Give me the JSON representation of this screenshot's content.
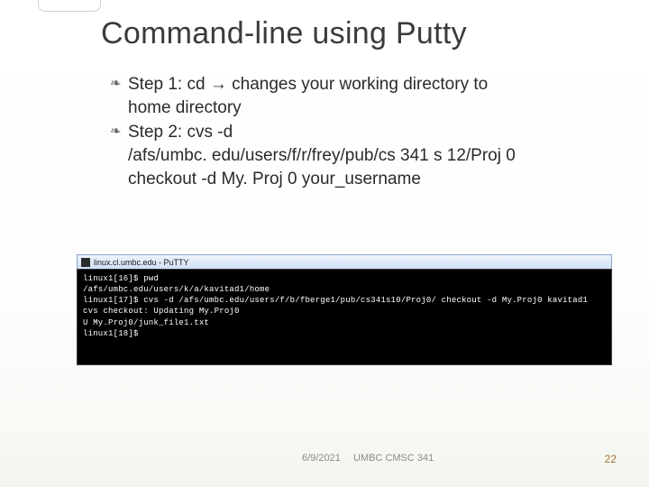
{
  "title": "Command-line using Putty",
  "bullets": {
    "step1": {
      "lead": "Step 1: cd ",
      "arrow": "→",
      "rest": " changes your working directory to",
      "cont": "home directory"
    },
    "step2": {
      "lead": "Step 2: cvs -d",
      "line2": "/afs/umbc. edu/users/f/r/frey/pub/cs 341 s 12/Proj 0",
      "line3": "checkout -d My. Proj 0 your_username"
    }
  },
  "terminal": {
    "title": "linux.cl.umbc.edu - PuTTY",
    "lines": [
      "linux1[16]$ pwd",
      "/afs/umbc.edu/users/k/a/kavitad1/home",
      "linux1[17]$ cvs -d /afs/umbc.edu/users/f/b/fberge1/pub/cs341s10/Proj0/ checkout -d My.Proj0 kavitad1",
      "cvs checkout: Updating My.Proj0",
      "U My.Proj0/junk_file1.txt",
      "linux1[18]$"
    ]
  },
  "footer": {
    "date": "6/9/2021",
    "center": "UMBC CMSC 341",
    "page": "22"
  }
}
